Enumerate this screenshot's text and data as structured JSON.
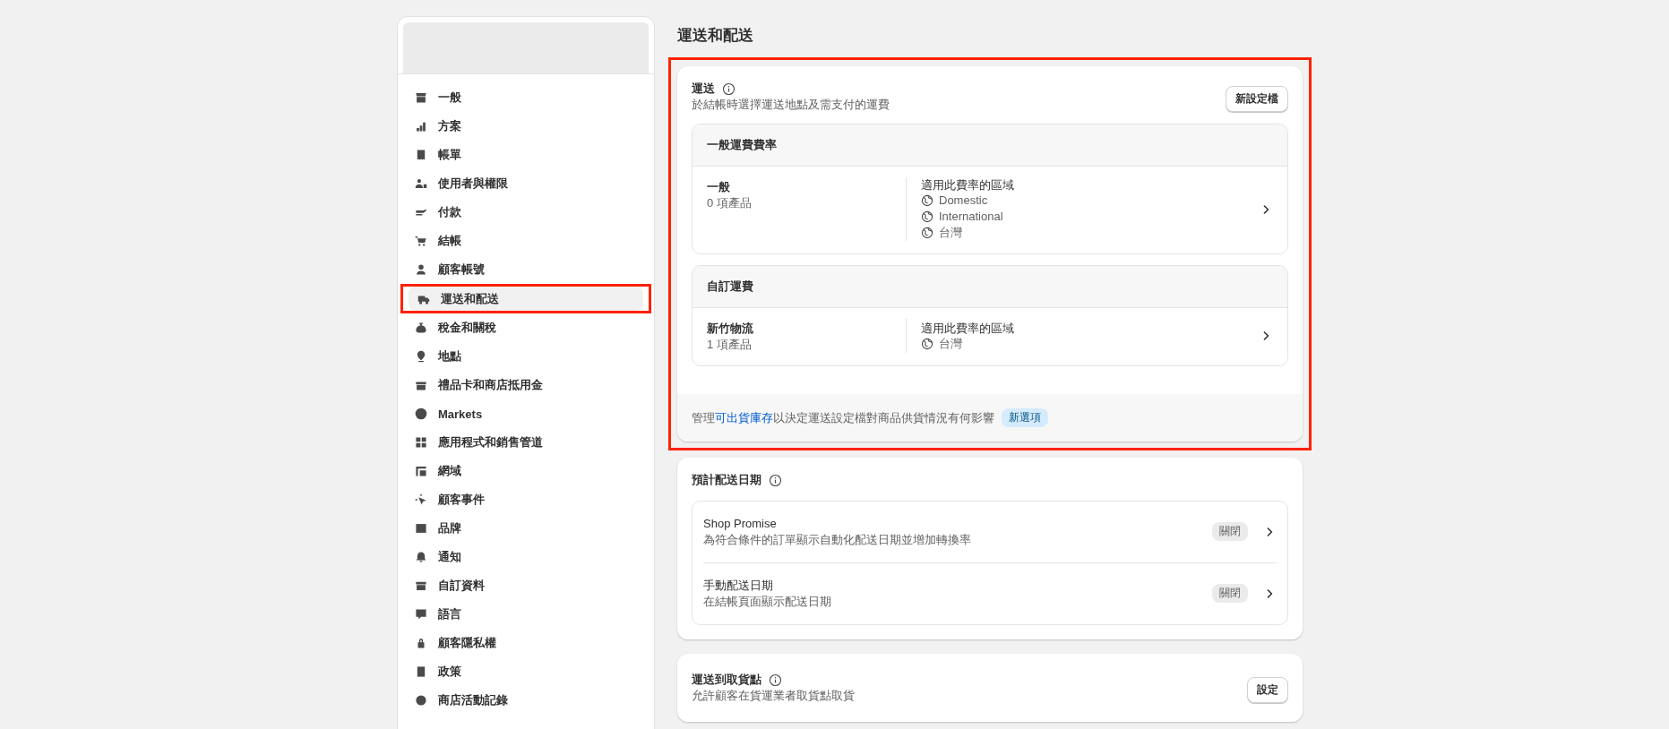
{
  "sidebar": {
    "items": [
      {
        "label": "一般",
        "selected": false,
        "highlighted": false
      },
      {
        "label": "方案",
        "selected": false,
        "highlighted": false
      },
      {
        "label": "帳單",
        "selected": false,
        "highlighted": false
      },
      {
        "label": "使用者與權限",
        "selected": false,
        "highlighted": false
      },
      {
        "label": "付款",
        "selected": false,
        "highlighted": false
      },
      {
        "label": "結帳",
        "selected": false,
        "highlighted": false
      },
      {
        "label": "顧客帳號",
        "selected": false,
        "highlighted": false
      },
      {
        "label": "運送和配送",
        "selected": true,
        "highlighted": true
      },
      {
        "label": "稅金和關稅",
        "selected": false,
        "highlighted": false
      },
      {
        "label": "地點",
        "selected": false,
        "highlighted": false
      },
      {
        "label": "禮品卡和商店抵用金",
        "selected": false,
        "highlighted": false
      },
      {
        "label": "Markets",
        "selected": false,
        "highlighted": false
      },
      {
        "label": "應用程式和銷售管道",
        "selected": false,
        "highlighted": false
      },
      {
        "label": "網域",
        "selected": false,
        "highlighted": false
      },
      {
        "label": "顧客事件",
        "selected": false,
        "highlighted": false
      },
      {
        "label": "品牌",
        "selected": false,
        "highlighted": false
      },
      {
        "label": "通知",
        "selected": false,
        "highlighted": false
      },
      {
        "label": "自訂資料",
        "selected": false,
        "highlighted": false
      },
      {
        "label": "語言",
        "selected": false,
        "highlighted": false
      },
      {
        "label": "顧客隱私權",
        "selected": false,
        "highlighted": false
      },
      {
        "label": "政策",
        "selected": false,
        "highlighted": false
      },
      {
        "label": "商店活動記錄",
        "selected": false,
        "highlighted": false
      }
    ]
  },
  "page_title": "運送和配送",
  "shipping": {
    "title": "運送",
    "subtitle": "於結帳時選擇運送地點及需支付的運費",
    "button": "新設定檔",
    "highlighted": true,
    "groups": [
      {
        "heading": "一般運費費率",
        "profiles": [
          {
            "name": "一般",
            "count": "0 項產品",
            "zones_label": "適用此費率的區域",
            "zones": [
              "Domestic",
              "International",
              "台灣"
            ]
          }
        ]
      },
      {
        "heading": "自訂運費",
        "profiles": [
          {
            "name": "新竹物流",
            "count": "1 項產品",
            "zones_label": "適用此費率的區域",
            "zones": [
              "台灣"
            ]
          }
        ]
      }
    ],
    "footer": {
      "before": "管理",
      "link": "可出貨庫存",
      "after": "以決定運送設定檔對商品供貨情況有何影響",
      "badge": "新選項"
    }
  },
  "delivery_dates": {
    "title": "預計配送日期",
    "options": [
      {
        "title": "Shop Promise",
        "description": "為符合條件的訂單顯示自動化配送日期並增加轉換率",
        "status": "關閉"
      },
      {
        "title": "手動配送日期",
        "description": "在結帳頁面顯示配送日期",
        "status": "關閉"
      }
    ]
  },
  "pickup": {
    "title": "運送到取貨點",
    "subtitle": "允許顧客在貨運業者取貨點取貨",
    "button": "設定"
  }
}
